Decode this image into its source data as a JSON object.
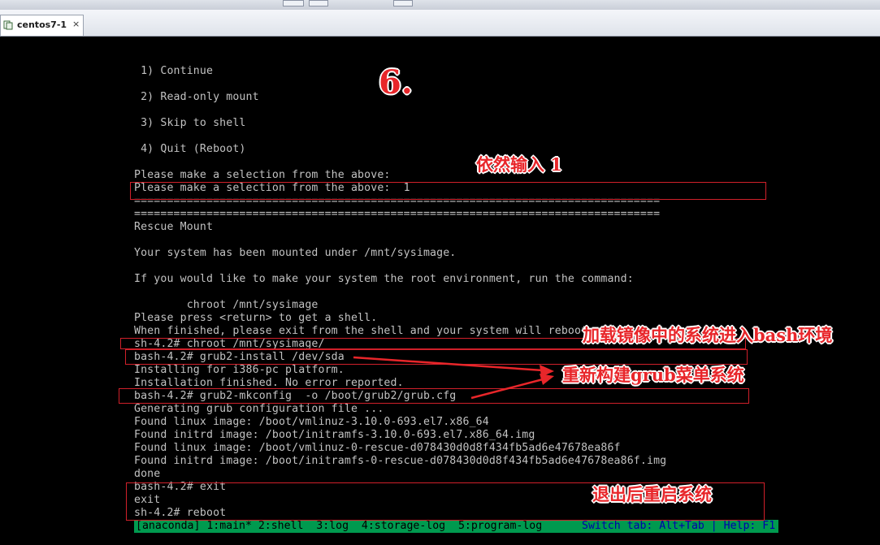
{
  "window": {
    "tab_label": "centos7-1",
    "tab_close": "×"
  },
  "console": {
    "lines": [
      " 1) Continue",
      " 2) Read-only mount",
      " 3) Skip to shell",
      " 4) Quit (Reboot)",
      "Please make a selection from the above:",
      "Please make a selection from the above:  1",
      "================================================================================",
      "================================================================================",
      "Rescue Mount",
      "Your system has been mounted under /mnt/sysimage.",
      "If you would like to make your system the root environment, run the command:",
      "        chroot /mnt/sysimage",
      "Please press <return> to get a shell.",
      "When finished, please exit from the shell and your system will reboot.",
      "sh-4.2# chroot /mnt/sysimage/",
      "bash-4.2# grub2-install /dev/sda",
      "Installing for i386-pc platform.",
      "Installation finished. No error reported.",
      "bash-4.2# grub2-mkconfig  -o /boot/grub2/grub.cfg",
      "Generating grub configuration file ...",
      "Found linux image: /boot/vmlinuz-3.10.0-693.el7.x86_64",
      "Found initrd image: /boot/initramfs-3.10.0-693.el7.x86_64.img",
      "Found linux image: /boot/vmlinuz-0-rescue-d078430d0d8f434fb5ad6e47678ea86f",
      "Found initrd image: /boot/initramfs-0-rescue-d078430d0d8f434fb5ad6e47678ea86f.img",
      "done",
      "bash-4.2# exit",
      "exit",
      "sh-4.2# reboot"
    ],
    "status_left": "[anaconda] 1:main* 2:shell  3:log  4:storage-log  5:program-log",
    "status_right": "Switch tab: Alt+Tab | Help: F1"
  },
  "annotations": {
    "step": "6.",
    "input_again": "依然输入 1",
    "load_system": "加载镜像中的系统进入bash环境",
    "rebuild_grub": "重新构建grub菜单系统",
    "exit_reboot": "退出后重启系统"
  },
  "colors": {
    "console_text": "#c2c2c2",
    "annotation_red": "#e8262a",
    "status_green": "#009a4f"
  }
}
